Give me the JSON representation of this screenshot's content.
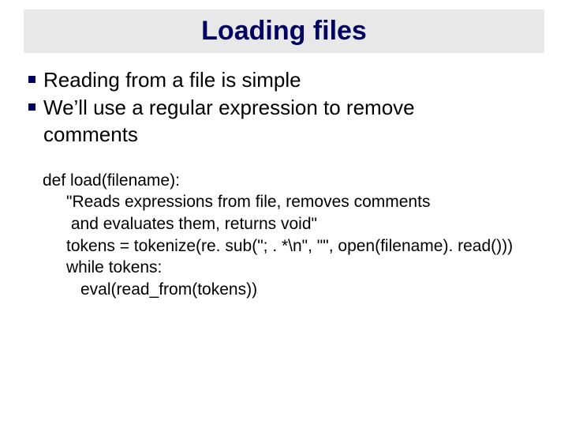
{
  "title": "Loading files",
  "bullets": {
    "b1": "Reading from a file is simple",
    "b2a": "We’ll use a regular expression to remove",
    "b2b": "comments"
  },
  "code": {
    "l1": "def load(filename):",
    "l2": "\"Reads expressions from file, removes comments",
    "l3": " and evaluates them, returns void\"",
    "l4": "tokens = tokenize(re. sub(\"; . *\\n\", \"\", open(filename). read()))",
    "l5": "while tokens:",
    "l6": "eval(read_from(tokens))"
  }
}
